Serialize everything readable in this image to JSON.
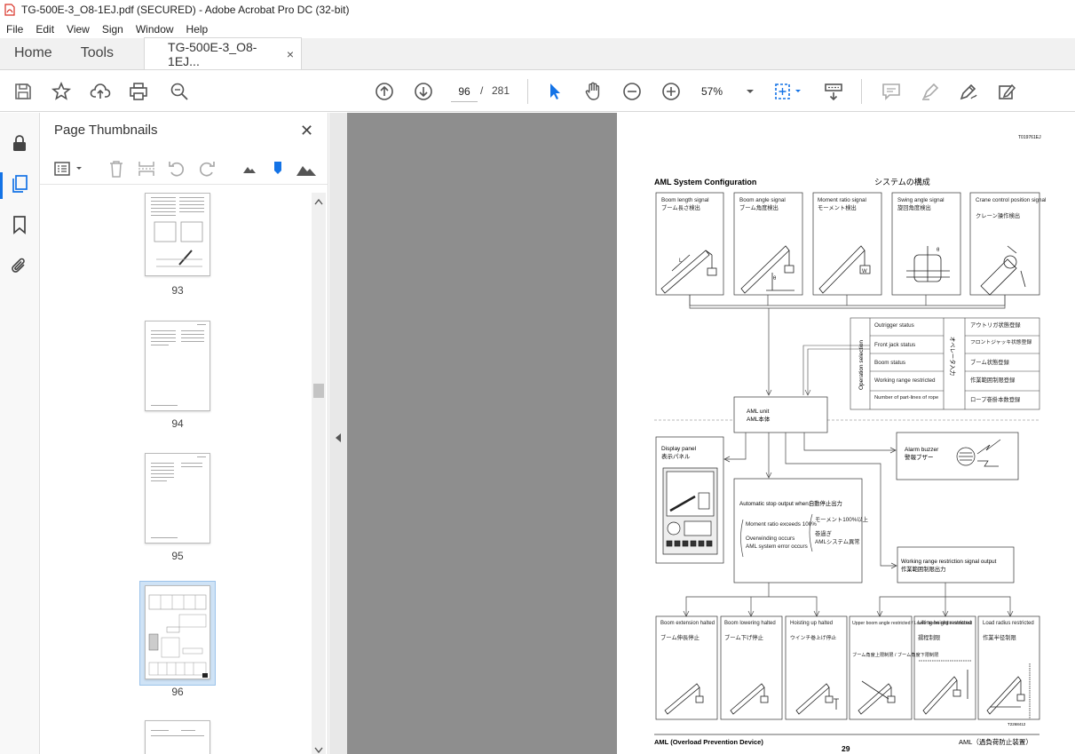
{
  "window": {
    "title": "TG-500E-3_O8-1EJ.pdf (SECURED) - Adobe Acrobat Pro DC (32-bit)"
  },
  "menu": [
    "File",
    "Edit",
    "View",
    "Sign",
    "Window",
    "Help"
  ],
  "tabs": {
    "home": "Home",
    "tools": "Tools",
    "document": "TG-500E-3_O8-1EJ...",
    "close_glyph": "×"
  },
  "toolbar": {
    "current_page": "96",
    "page_separator": "/",
    "total_pages": "281",
    "zoom": "57%"
  },
  "panel": {
    "title": "Page Thumbnails",
    "close_glyph": "✕",
    "thumbnails": [
      "93",
      "94",
      "95",
      "96"
    ],
    "selected": "96"
  },
  "pdf": {
    "doc_code": "T019761EJ",
    "section_title_en": "AML System Configuration",
    "section_title_jp": "システムの構成",
    "signals": [
      {
        "en": "Boom length signal",
        "jp": "ブーム長さ検出"
      },
      {
        "en": "Boom angle signal",
        "jp": "ブーム角度検出"
      },
      {
        "en": "Moment ratio signal",
        "jp": "モーメント検出"
      },
      {
        "en": "Swing angle signal",
        "jp": "旋回角度検出"
      },
      {
        "en": "Crane control position signal",
        "jp": "クレーン操作検出"
      }
    ],
    "operation_selection": "Operation selection",
    "operation_vertical_jp": "オペレータ入力",
    "operation_items": [
      {
        "en": "Outrigger status",
        "jp": "アウトリガ状態登録"
      },
      {
        "en": "Front jack status",
        "jp": "フロントジャッキ状態登録"
      },
      {
        "en": "Boom status",
        "jp": "ブーム状態登録"
      },
      {
        "en": "Working range restricted",
        "jp": "作業範囲制限登録"
      },
      {
        "en": "Number of part-lines of rope",
        "jp": "ロープ巻掛本数登録"
      }
    ],
    "aml_unit": {
      "en": "AML unit",
      "jp": "AML本体"
    },
    "display_panel": {
      "en": "Display panel",
      "jp": "表示パネル"
    },
    "alarm_buzzer": {
      "en": "Alarm buzzer",
      "jp": "警報ブザー"
    },
    "auto_stop": {
      "title_en": "Automatic stop output when:",
      "title_jp": "自動停止出力",
      "items_en": [
        "Moment ratio exceeds 100%",
        "Overwinding occurs",
        "AML system error occurs"
      ],
      "items_jp": [
        "モーメント100%以上",
        "巻過ぎ",
        "AMLシステム異常"
      ]
    },
    "working_range_output": {
      "en": "Working range restriction signal output",
      "jp": "作業範囲制限出力"
    },
    "outputs": [
      {
        "en": "Boom extension halted",
        "jp": "ブーム伸長停止"
      },
      {
        "en": "Boom lowering halted",
        "jp": "ブーム下げ停止"
      },
      {
        "en": "Hoisting up halted",
        "jp": "ウインチ巻上げ停止"
      },
      {
        "en": "Upper boom angle restricted / Lower boom angle restricted",
        "jp": "ブーム角度上限制限 / ブーム角度下限制限"
      },
      {
        "en": "Lifting height restricted",
        "jp": "揚程制限"
      },
      {
        "en": "Load radius restricted",
        "jp": "作業半径制限"
      }
    ],
    "figure_code": "T2268412",
    "footer_left": "AML (Overload Prevention Device)",
    "footer_right": "AML（過負荷防止装置）",
    "page_number": "29"
  },
  "colors": {
    "accent": "#1473e6",
    "viewer_bg": "#8e8e8e",
    "pdf_red": "#d93025"
  }
}
